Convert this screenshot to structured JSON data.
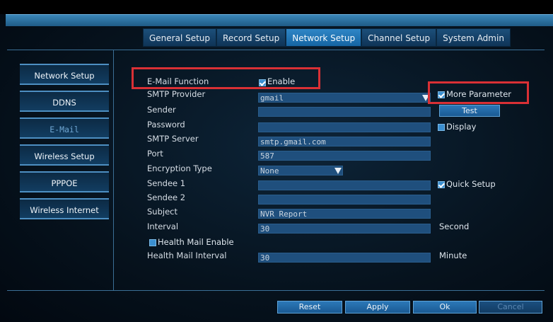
{
  "tabs": [
    "General Setup",
    "Record Setup",
    "Network Setup",
    "Channel Setup",
    "System Admin"
  ],
  "active_tab": "Network Setup",
  "sidebar": {
    "items": [
      "Network Setup",
      "DDNS",
      "E-Mail",
      "Wireless Setup",
      "PPPOE",
      "Wireless Internet"
    ],
    "active": "E-Mail"
  },
  "email": {
    "function_label": "E-Mail Function",
    "enable_label": "Enable",
    "enable_checked": true,
    "smtp_provider_label": "SMTP Provider",
    "smtp_provider_value": "gmail",
    "more_parameter_label": "More Parameter",
    "more_parameter_checked": true,
    "sender_label": "Sender",
    "sender_value": "",
    "test_label": "Test",
    "password_label": "Password",
    "password_value": "",
    "display_label": "Display",
    "display_checked": false,
    "smtp_server_label": "SMTP Server",
    "smtp_server_value": "smtp.gmail.com",
    "port_label": "Port",
    "port_value": "587",
    "encryption_label": "Encryption Type",
    "encryption_value": "None",
    "sendee1_label": "Sendee 1",
    "sendee1_value": "",
    "quick_setup_label": "Quick Setup",
    "quick_setup_checked": true,
    "sendee2_label": "Sendee 2",
    "sendee2_value": "",
    "subject_label": "Subject",
    "subject_value": "NVR Report",
    "interval_label": "Interval",
    "interval_value": "30",
    "interval_unit": "Second",
    "health_enable_label": "Health Mail Enable",
    "health_enable_checked": false,
    "health_interval_label": "Health Mail Interval",
    "health_interval_value": "30",
    "health_interval_unit": "Minute"
  },
  "buttons": {
    "reset": "Reset",
    "apply": "Apply",
    "ok": "Ok",
    "cancel": "Cancel"
  },
  "colors": {
    "highlight": "#d93035",
    "accent": "#2f86c6",
    "field": "#1f4f7d"
  }
}
